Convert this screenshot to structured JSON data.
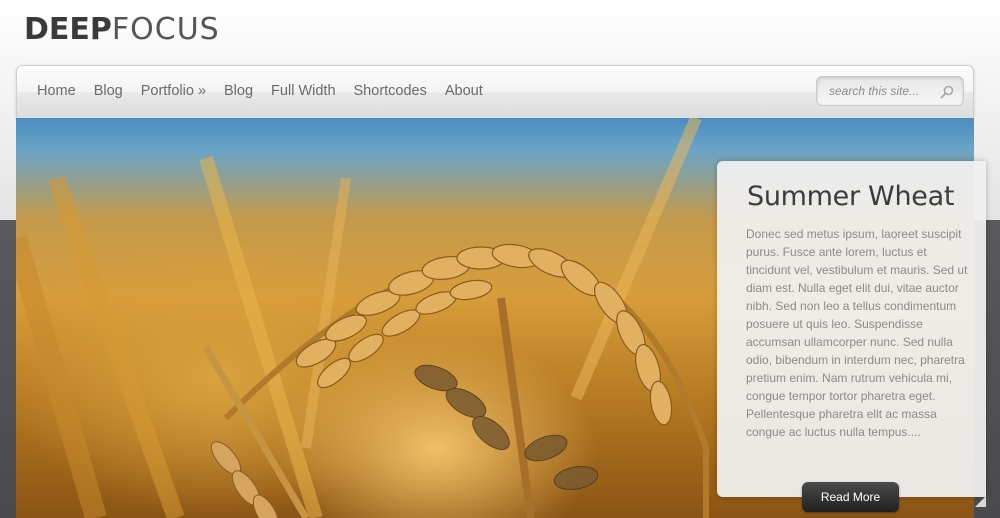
{
  "header": {
    "logo_bold": "DEEP",
    "logo_light": "FOCUS"
  },
  "nav": {
    "items": [
      {
        "label": "Home"
      },
      {
        "label": "Blog"
      },
      {
        "label": "Portfolio »"
      },
      {
        "label": "Blog"
      },
      {
        "label": "Full Width"
      },
      {
        "label": "Shortcodes"
      },
      {
        "label": "About"
      }
    ],
    "search_placeholder": "search this site..."
  },
  "slide": {
    "title": "Summer Wheat",
    "text": "Donec sed metus ipsum, laoreet suscipit purus. Fusce ante lorem, luctus et tincidunt vel, vestibulum et mauris. Sed ut diam est. Nulla eget elit dui, vitae auctor nibh. Sed non leo a tellus condimentum posuere ut quis leo. Suspendisse accumsan ullamcorper nunc. Sed nulla odio, bibendum in interdum nec, pharetra pretium enim. Nam rutrum vehicula mi, congue tempor tortor pharetra eget. Pellentesque pharetra elit ac massa congue ac luctus nulla tempus....",
    "button_label": "Read More"
  },
  "icons": {
    "search": "search-icon",
    "corner": "corner-arrow-icon"
  },
  "colors": {
    "button_dark": "#2a2a2a",
    "nav_text": "#6a6a6a",
    "caption_bg": "#f0f0f0"
  }
}
